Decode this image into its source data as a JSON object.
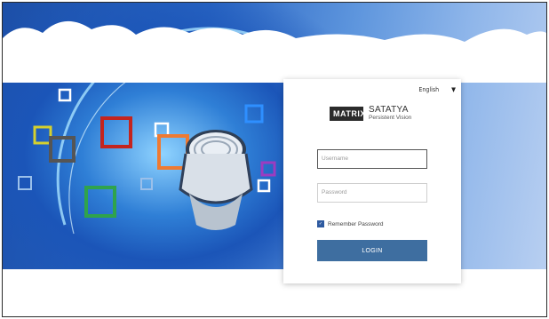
{
  "login": {
    "language": "English",
    "brand": "MATRIX",
    "product_name": "SATATYA",
    "product_tagline": "Persistent Vision",
    "username_placeholder": "Username",
    "password_placeholder": "Password",
    "remember_label": "Remember Password",
    "remember_checked": true,
    "login_button": "LOGIN"
  },
  "colors": {
    "button": "#3e6ea0",
    "hero_blue": "#1c4fa8"
  }
}
